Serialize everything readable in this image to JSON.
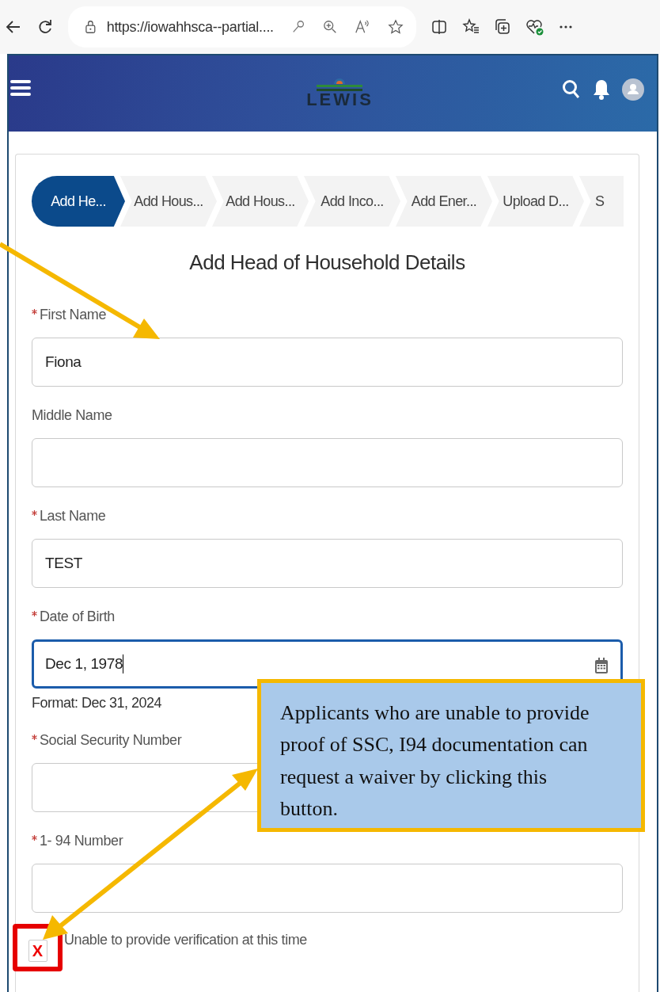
{
  "browser": {
    "url": "https://iowahhsca--partial...."
  },
  "header": {
    "logo_text": "LEWIS"
  },
  "steps": [
    {
      "label": "Add He...",
      "selected": true
    },
    {
      "label": "Add Hous...",
      "selected": false
    },
    {
      "label": "Add Hous...",
      "selected": false
    },
    {
      "label": "Add Inco...",
      "selected": false
    },
    {
      "label": "Add Ener...",
      "selected": false
    },
    {
      "label": "Upload D...",
      "selected": false
    },
    {
      "label": "S",
      "selected": false
    }
  ],
  "title": "Add Head of Household Details",
  "fields": [
    {
      "kind": "text",
      "label": "First Name",
      "required": true,
      "value": "Fiona",
      "focused": false
    },
    {
      "kind": "text",
      "label": "Middle Name",
      "required": false,
      "focused": false
    },
    {
      "kind": "text",
      "label": "Last Name",
      "required": true,
      "value": "TEST",
      "focused": false
    },
    {
      "kind": "date",
      "label": "Date of Birth",
      "required": true,
      "value": "Dec 1, 1978",
      "focused": true,
      "hint": "Format: Dec 31, 2024"
    },
    {
      "kind": "text",
      "label": "Social Security Number",
      "required": true,
      "focused": false
    },
    {
      "kind": "text",
      "label": "1- 94 Number",
      "required": true,
      "focused": false
    }
  ],
  "checkbox": {
    "label": "Unable to provide verification at this time"
  },
  "annotation": {
    "callout": "Applicants who are unable to provide proof of SSC, I94 documentation can request a waiver by clicking this button.",
    "mark": "X"
  }
}
